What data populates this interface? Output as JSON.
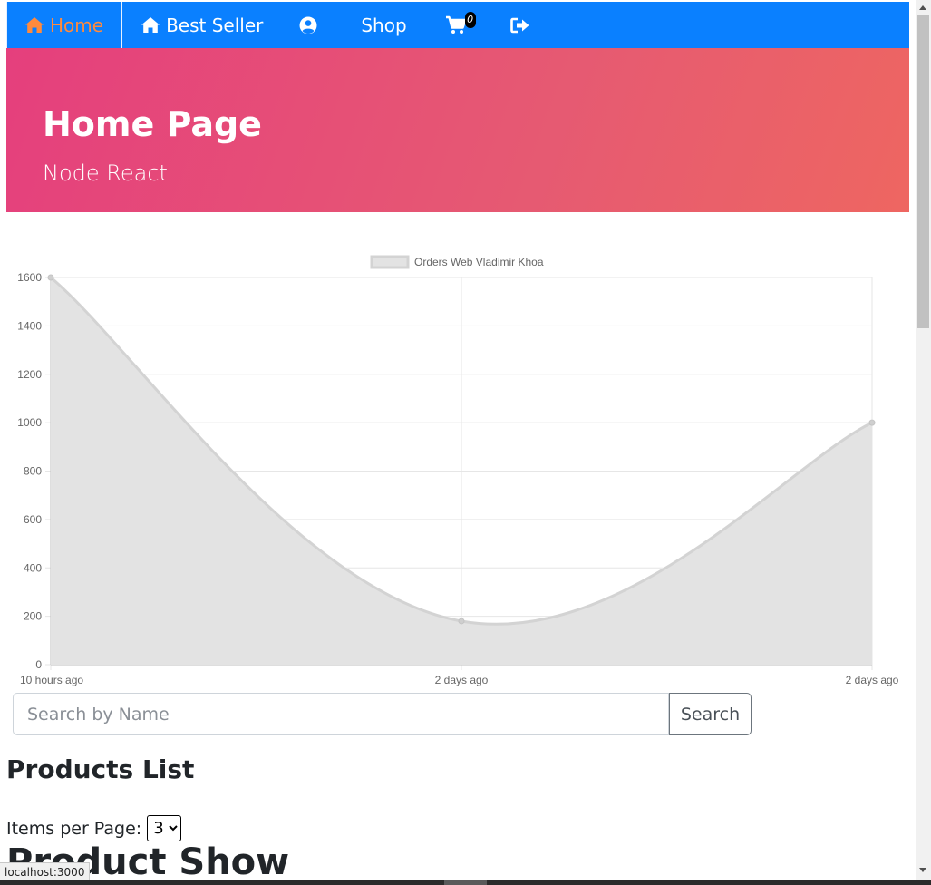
{
  "navbar": {
    "home_label": "Home",
    "best_seller_label": "Best Seller",
    "shop_label": "Shop",
    "cart_count": "0",
    "icons": [
      "home-icon",
      "home-icon",
      "user-circle-icon",
      "shopping-cart-icon",
      "sign-out-icon"
    ],
    "active_color": "#ff8a3d",
    "bg_color": "#0a80ff"
  },
  "hero": {
    "title": "Home Page",
    "subtitle": "Node React"
  },
  "chart_data": {
    "type": "area",
    "x": [
      "10 hours ago",
      "2 days ago",
      "2 days ago"
    ],
    "series": [
      {
        "name": "Orders Web Vladimir Khoa",
        "values": [
          1600,
          180,
          1000
        ]
      }
    ],
    "ylim": [
      0,
      1600
    ],
    "yticks": [
      0,
      200,
      400,
      600,
      800,
      1000,
      1200,
      1400,
      1600
    ],
    "legend_position": "top",
    "grid": true,
    "fill_color": "#e3e3e3",
    "line_color": "#d3d3d3"
  },
  "search": {
    "placeholder": "Search by Name",
    "button_label": "Search"
  },
  "products": {
    "title": "Products List",
    "items_per_page_label": "Items per Page:",
    "items_per_page_value": "3",
    "show_title": "Product Show"
  },
  "status_url": "localhost:3000"
}
